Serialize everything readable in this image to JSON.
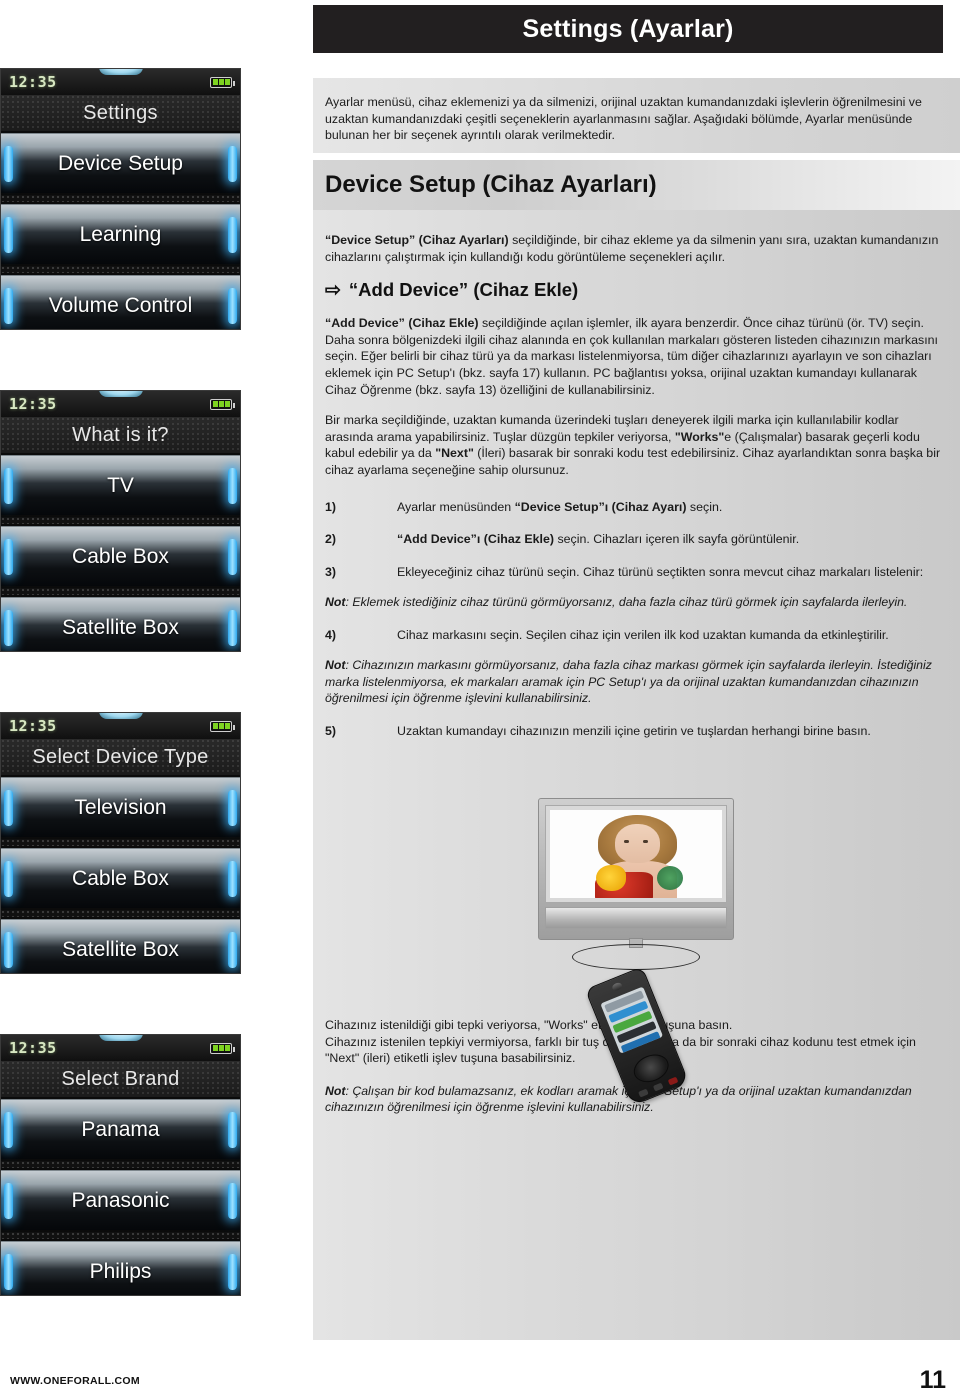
{
  "header": {
    "title": "Settings (Ayarlar)"
  },
  "intro": {
    "paragraph": "Ayarlar menüsü, cihaz eklemenizi ya da silmenizi, orijinal uzaktan kumandanızdaki işlevlerin öğrenilmesini ve uzaktan kumandanızdaki çeşitli seçeneklerin ayarlanmasını sağlar. Aşağıdaki bölümde, Ayarlar menüsünde bulunan her bir seçenek ayrıntılı olarak verilmektedir."
  },
  "section": {
    "heading": "Device Setup (Cihaz Ayarları)",
    "intro_bold": "“Device Setup” (Cihaz Ayarları)",
    "intro_rest": " seçildiğinde, bir cihaz ekleme ya da silmenin yanı sıra, uzaktan kumandanızın cihazlarını çalıştırmak için kullandığı kodu görüntüleme seçenekleri açılır."
  },
  "subsection": {
    "arrow_icon": "⇨",
    "heading": "“Add Device” (Cihaz Ekle)",
    "p1_bold": "“Add Device” (Cihaz Ekle)",
    "p1_rest": " seçildiğinde açılan işlemler, ilk ayara benzerdir. Önce cihaz türünü (ör. TV) seçin. Daha sonra bölgenizdeki ilgili cihaz alanında en çok kullanılan markaları gösteren listeden cihazınızın markasını seçin. Eğer belirli bir cihaz türü ya da markası listelenmiyorsa, tüm diğer cihazlarınızı ayarlayın ve son cihazları eklemek için PC Setup'ı (bkz. sayfa 17) kullanın. PC bağlantısı yoksa, orijinal uzaktan kumandayı kullanarak Cihaz Öğrenme (bkz. sayfa 13) özelliğini de kullanabilirsiniz.",
    "p2_a": "Bir marka seçildiğinde, uzaktan kumanda üzerindeki tuşları deneyerek ilgili marka için kullanılabilir kodlar arasında arama yapabilirsiniz. Tuşlar düzgün tepkiler veriyorsa, ",
    "p2_b1": "\"Works\"",
    "p2_c": "e (Çalışmalar) basarak geçerli kodu kabul edebilir ya da ",
    "p2_b2": "\"Next\"",
    "p2_d": " (İleri) basarak bir sonraki kodu test edebilirsiniz. Cihaz ayarlandıktan sonra başka bir cihaz ayarlama seçeneğine sahip olursunuz."
  },
  "steps": [
    {
      "n": "1)",
      "pre": "Ayarlar menüsünden ",
      "bold": "“Device Setup”ı (Cihaz Ayarı)",
      "post": " seçin."
    },
    {
      "n": "2)",
      "pre": "",
      "bold": "“Add Device”ı (Cihaz Ekle)",
      "post": " seçin. Cihazları içeren ilk sayfa görüntülenir."
    },
    {
      "n": "3)",
      "pre": "Ekleyeceğiniz cihaz türünü seçin. Cihaz türünü seçtikten sonra mevcut cihaz markaları listelenir:",
      "bold": "",
      "post": ""
    },
    {
      "n": "4)",
      "pre": "Cihaz markasını seçin. Seçilen cihaz için verilen ilk kod uzaktan kumanda da etkinleştirilir.",
      "bold": "",
      "post": ""
    },
    {
      "n": "5)",
      "pre": "Uzaktan kumandayı cihazınızın menzili içine getirin ve tuşlardan herhangi birine basın.",
      "bold": "",
      "post": ""
    }
  ],
  "notes": {
    "label": "Not",
    "note1": ": Eklemek istediğiniz cihaz türünü görmüyorsanız, daha fazla cihaz türü görmek için sayfalarda ilerleyin.",
    "note2": ": Cihazınızın markasını görmüyorsanız, daha fazla cihaz markası görmek için sayfalarda ilerleyin. İstediğiniz marka listelenmiyorsa, ek markaları aramak için PC Setup'ı ya da orijinal uzaktan kumandanızdan cihazınızın öğrenilmesi için öğrenme işlevini kullanabilirsiniz.",
    "note3": ": Çalışan bir kod bulamazsanız, ek kodları aramak için PC Setup'ı ya da orijinal uzaktan kumandanızdan cihazınızın öğrenilmesi için öğrenme işlevini kullanabilirsiniz."
  },
  "closing": {
    "line1": "Cihazınız istenildiği gibi tepki veriyorsa, \"Works\" etiketli işlev tuşuna basın.",
    "line2": "Cihazınız istenilen tepkiyi vermiyorsa, farklı bir tuş deneyebilir ya da bir sonraki cihaz kodunu test etmek için \"Next\" (ileri) etiketli işlev tuşuna basabilirsiniz."
  },
  "device_screens": [
    {
      "clock": "12:35",
      "title": "Settings",
      "items": [
        "Device Setup",
        "Learning",
        "Volume Control"
      ],
      "pager_active": 0
    },
    {
      "clock": "12:35",
      "title": "What is it?",
      "items": [
        "TV",
        "Cable Box",
        "Satellite Box"
      ],
      "pager_active": 0
    },
    {
      "clock": "12:35",
      "title": "Select Device Type",
      "items": [
        "Television",
        "Cable Box",
        "Satellite Box"
      ],
      "pager_active": 0
    },
    {
      "clock": "12:35",
      "title": "Select Brand",
      "items": [
        "Panama",
        "Panasonic",
        "Philips"
      ],
      "pager_active": 3
    }
  ],
  "footer": {
    "url": "WWW.ONEFORALL.COM",
    "page": "11"
  },
  "colors": {
    "title_bar": "#221f20",
    "accent_blue": "#2ea9ef",
    "battery_green": "#7ed321",
    "clock_green": "#d7e7c2"
  }
}
